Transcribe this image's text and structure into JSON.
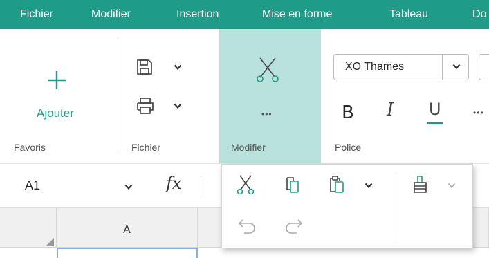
{
  "menu": {
    "items": [
      "Fichier",
      "Modifier",
      "Insertion",
      "Mise en forme",
      "Tableau",
      "Do"
    ]
  },
  "ribbon": {
    "favoris": {
      "add_label": "Ajouter",
      "group_label": "Favoris"
    },
    "fichier": {
      "group_label": "Fichier"
    },
    "modifier": {
      "group_label": "Modifier",
      "more_label": "•••"
    },
    "police": {
      "group_label": "Police",
      "font_name": "XO Thames",
      "bold_label": "B",
      "italic_label": "I",
      "underline_label": "U",
      "more_label": "•••"
    }
  },
  "formula_bar": {
    "cell_reference": "A1",
    "fx_label": "fx"
  },
  "grid": {
    "columns": [
      "A"
    ]
  },
  "colors": {
    "accent": "#1f9c89",
    "active_group": "#b9e2dc",
    "selection": "#7fb2e5"
  },
  "icons": {
    "ribbon": [
      "plus-icon",
      "save-icon",
      "print-icon",
      "scissors-icon",
      "more-icon",
      "chevron-down-icon"
    ],
    "popup": [
      "scissors-icon",
      "copy-icon",
      "paste-icon",
      "chevron-down-icon",
      "format-painter-icon",
      "undo-icon",
      "redo-icon"
    ]
  }
}
